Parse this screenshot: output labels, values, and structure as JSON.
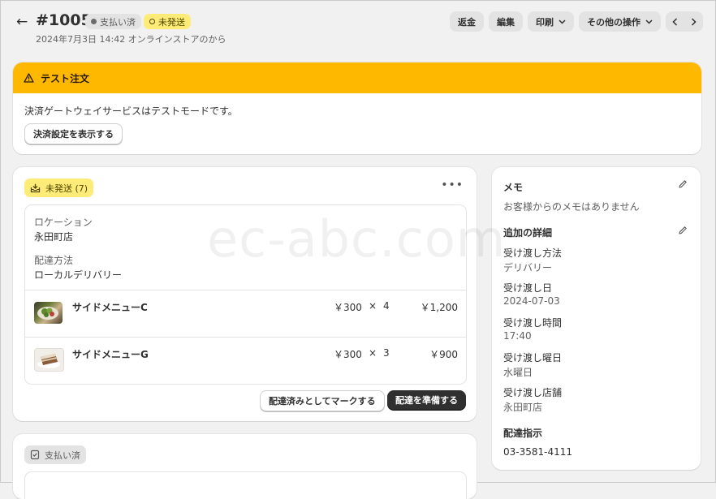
{
  "header": {
    "back_icon": "arrow-left-icon",
    "order_number": "#1005",
    "payment_badge": "支払い済",
    "fulfillment_badge": "未発送",
    "subtitle": "2024年7月3日 14:42 オンラインストアのから",
    "buttons": {
      "refund": "返金",
      "edit": "編集",
      "print": "印刷",
      "more": "その他の操作"
    }
  },
  "test_banner": {
    "title": "テスト注文",
    "message": "決済ゲートウェイサービスはテストモードです。",
    "button": "決済設定を表示する",
    "accent_color": "#ffb800"
  },
  "fulfillment": {
    "badge": "未発送 (7)",
    "location_label": "ロケーション",
    "location_value": "永田町店",
    "method_label": "配達方法",
    "method_value": "ローカルデリバリー",
    "items": [
      {
        "name": "サイドメニューC",
        "price": "￥300",
        "times": "×",
        "qty": "4",
        "total": "￥1,200"
      },
      {
        "name": "サイドメニューG",
        "price": "￥300",
        "times": "×",
        "qty": "3",
        "total": "￥900"
      }
    ],
    "mark_button": "配達済みとしてマークする",
    "prepare_button": "配達を準備する"
  },
  "payment": {
    "badge": "支払い済"
  },
  "sidebar": {
    "memo_title": "メモ",
    "memo_text": "お客様からのメモはありません",
    "details_title": "追加の詳細",
    "details": [
      {
        "label": "受け渡し方法",
        "value": "デリバリー"
      },
      {
        "label": "受け渡し日",
        "value": "2024-07-03"
      },
      {
        "label": "受け渡し時間",
        "value": "17:40"
      },
      {
        "label": "受け渡し曜日",
        "value": "水曜日"
      },
      {
        "label": "受け渡し店舗",
        "value": "永田町店"
      }
    ],
    "delivery_title": "配達指示",
    "delivery_value": "03-3581-4111"
  },
  "watermark": "ec-abc.com"
}
